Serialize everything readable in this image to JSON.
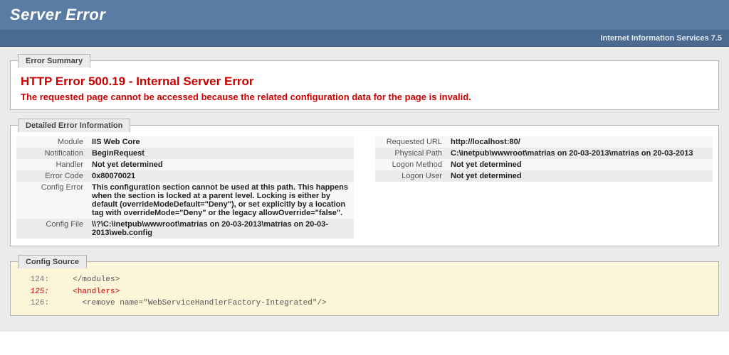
{
  "header": {
    "title": "Server Error"
  },
  "subheader": {
    "text": "Internet Information Services 7.5"
  },
  "summary": {
    "legend": "Error Summary",
    "title": "HTTP Error 500.19 - Internal Server Error",
    "message": "The requested page cannot be accessed because the related configuration data for the page is invalid."
  },
  "details": {
    "legend": "Detailed Error Information",
    "left": [
      {
        "label": "Module",
        "value": "IIS Web Core"
      },
      {
        "label": "Notification",
        "value": "BeginRequest"
      },
      {
        "label": "Handler",
        "value": "Not yet determined"
      },
      {
        "label": "Error Code",
        "value": "0x80070021"
      },
      {
        "label": "Config Error",
        "value": "This configuration section cannot be used at this path. This happens when the section is locked at a parent level. Locking is either by default (overrideModeDefault=\"Deny\"), or set explicitly by a location tag with overrideMode=\"Deny\" or the legacy allowOverride=\"false\"."
      },
      {
        "label": "Config File",
        "value": "\\\\?\\C:\\inetpub\\wwwroot\\matrias on 20-03-2013\\matrias on 20-03-2013\\web.config"
      }
    ],
    "right": [
      {
        "label": "Requested URL",
        "value": "http://localhost:80/"
      },
      {
        "label": "Physical Path",
        "value": "C:\\inetpub\\wwwroot\\matrias on 20-03-2013\\matrias on 20-03-2013"
      },
      {
        "label": "Logon Method",
        "value": "Not yet determined"
      },
      {
        "label": "Logon User",
        "value": "Not yet determined"
      }
    ]
  },
  "config": {
    "legend": "Config Source",
    "lines": [
      {
        "num": "124:",
        "code": "  </modules>",
        "hl": false
      },
      {
        "num": "125:",
        "code": "  <handlers>",
        "hl": true
      },
      {
        "num": "126:",
        "code": "    <remove name=\"WebServiceHandlerFactory-Integrated\"/>",
        "hl": false
      }
    ]
  }
}
